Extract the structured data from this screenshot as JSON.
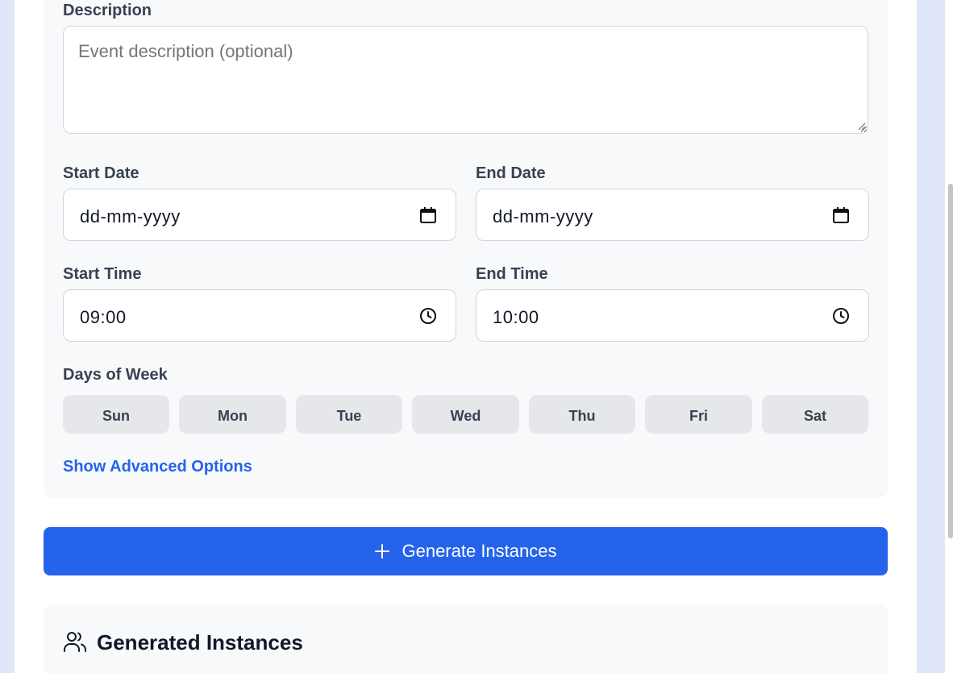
{
  "form": {
    "description": {
      "label": "Description",
      "placeholder": "Event description (optional)"
    },
    "start_date": {
      "label": "Start Date",
      "value": "dd-mm-yyyy",
      "icon": "calendar-icon"
    },
    "end_date": {
      "label": "End Date",
      "value": "dd-mm-yyyy",
      "icon": "calendar-icon"
    },
    "start_time": {
      "label": "Start Time",
      "value": "09:00",
      "icon": "clock-icon"
    },
    "end_time": {
      "label": "End Time",
      "value": "10:00",
      "icon": "clock-icon"
    },
    "days_of_week": {
      "label": "Days of Week",
      "days": [
        "Sun",
        "Mon",
        "Tue",
        "Wed",
        "Thu",
        "Fri",
        "Sat"
      ]
    },
    "advanced_link": "Show Advanced Options"
  },
  "actions": {
    "generate_label": "Generate Instances",
    "generate_icon": "plus-icon"
  },
  "results": {
    "title": "Generated Instances",
    "icon": "users-icon"
  },
  "colors": {
    "primary": "#2563eb",
    "card_bg": "#f8f9fb",
    "day_button_bg": "#e5e7eb",
    "page_bg": "#e0e7fb"
  }
}
